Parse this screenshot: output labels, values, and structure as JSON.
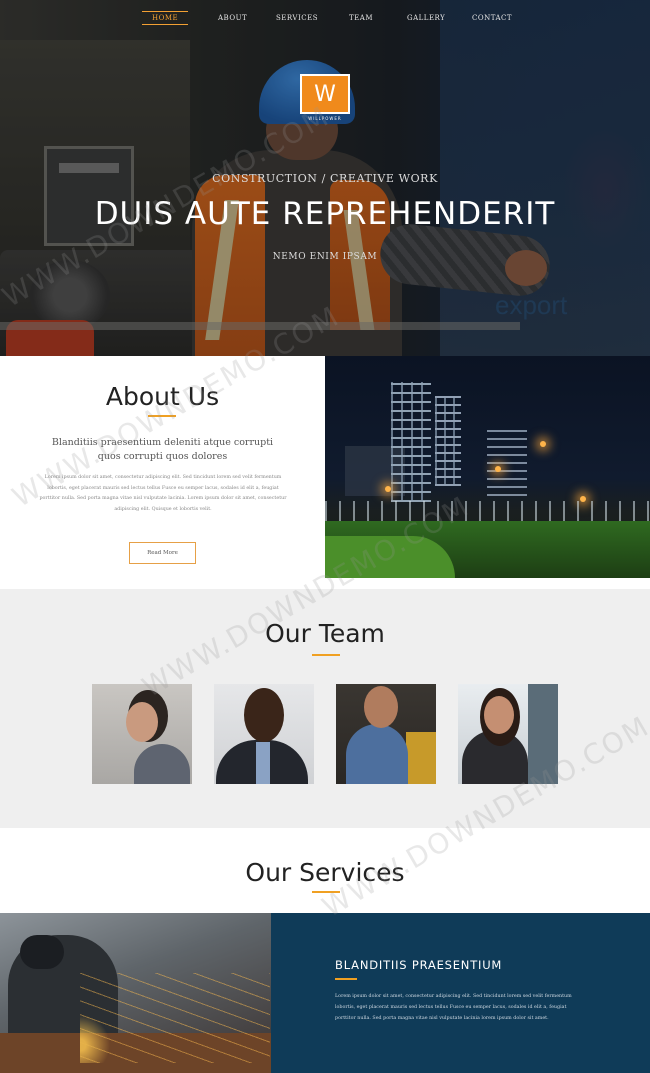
{
  "nav": {
    "items": [
      "HOME",
      "ABOUT",
      "SERVICES",
      "TEAM",
      "GALLERY",
      "CONTACT"
    ],
    "active": "HOME"
  },
  "logo": {
    "letter": "W",
    "name": "WILLPOWER"
  },
  "hero": {
    "subtitle": "CONSTRUCTION / CREATIVE WORK",
    "title": "DUIS AUTE REPREHENDERIT",
    "tagline": "NEMO ENIM IPSAM",
    "bg_text": "export"
  },
  "about": {
    "heading": "About Us",
    "lead": "Blanditiis praesentium deleniti atque corrupti quos corrupti quos dolores",
    "body": "Lorem ipsum dolor sit amet, consectetur adipiscing elit. Sed tincidunt lorem sed velit fermentum lobortis, eget placerat mauris sed lectus tellus Fusce eu semper lacus, sodales id elit a, feugiat porttitor nulla. Sed porta magna vitae nisl vulputate lacinia. Lorem ipsum dolor sit amet, consectetur adipiscing elit. Quisque et lobortis velit.",
    "button": "Read More"
  },
  "team": {
    "heading": "Our Team"
  },
  "services": {
    "heading": "Our Services",
    "panel_title": "BLANDITIIS PRAESENTIUM",
    "panel_body": "Lorem ipsum dolor sit amet, consectetur adipiscing elit. Sed tincidunt lorem sed velit fermentum lobortis, eget placerat mauris sed lectus tellus Fusce eu semper lacus, sodales id elit a, feugiat porttitor nulla. Sed porta magna vitae nisl vulputate lacinia lorem ipsum dolor sit amet."
  },
  "watermark": "WWW.DOWNDEMO.COM",
  "colors": {
    "accent": "#f0a022",
    "panel": "#0f3b58",
    "logo": "#f08a1c"
  }
}
